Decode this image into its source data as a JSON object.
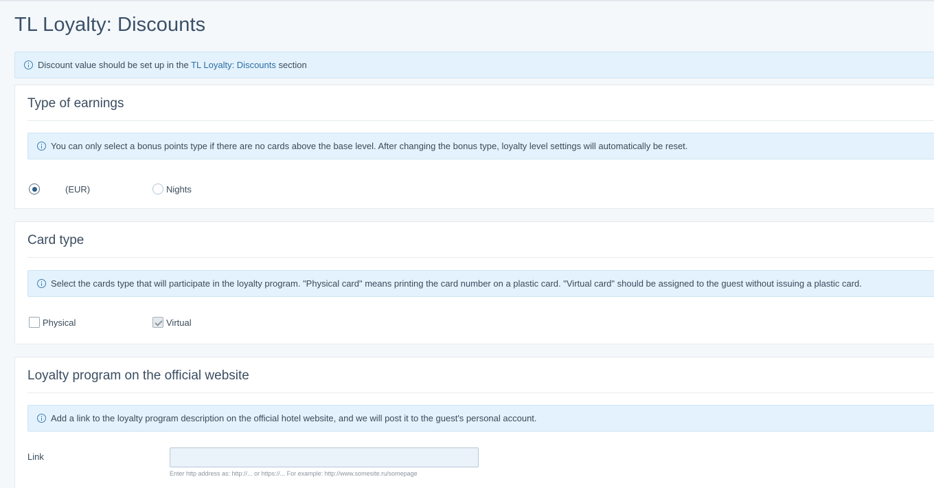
{
  "page": {
    "title": "TL Loyalty: Discounts"
  },
  "top_notice": {
    "icon": "info-icon",
    "text_before": "Discount value should be set up in the ",
    "link": "TL Loyalty: Discounts",
    "text_after": " section"
  },
  "earnings": {
    "title": "Type of earnings",
    "notice": "You can only select a bonus points type if there are no cards above the base level. After changing the bonus type, loyalty level settings will automatically be reset.",
    "options": [
      {
        "label": "(EUR)",
        "checked": true
      },
      {
        "label": "Nights",
        "checked": false
      }
    ]
  },
  "card_type": {
    "title": "Card type",
    "notice": "Select the cards type that will participate in the loyalty program. \"Physical card\" means printing the card number on a plastic card. \"Virtual card\" should be assigned to the guest without issuing a plastic card.",
    "options": [
      {
        "label": "Physical",
        "checked": false
      },
      {
        "label": "Virtual",
        "checked": true,
        "disabled": true
      }
    ]
  },
  "website": {
    "title": "Loyalty program on the official website",
    "notice": "Add a link to the loyalty program description on the official hotel website, and we will post it to the guest's personal account.",
    "link_label": "Link",
    "link_value": "",
    "link_hint": "Enter http address as: http://... or https://... For example: http://www.somesite.ru/somepage"
  },
  "colors": {
    "background": "#f5f8fb",
    "notice_bg": "#e3f2fc",
    "link": "#2f6da3",
    "input_bg": "#eaf2fa"
  }
}
